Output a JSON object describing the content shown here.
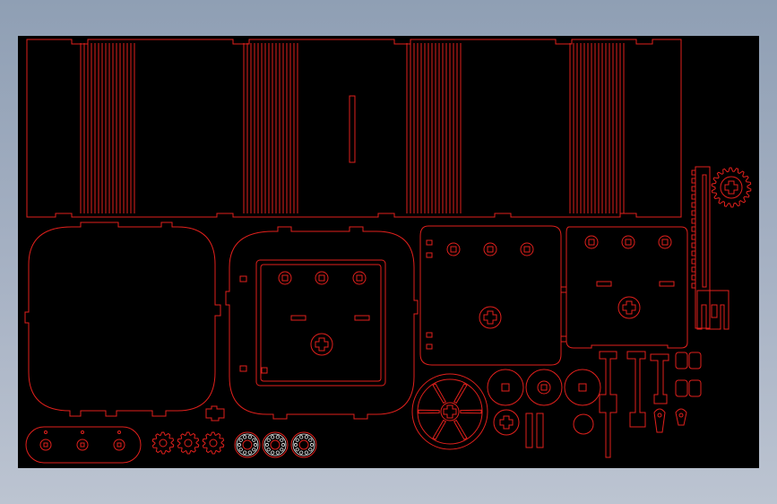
{
  "view": {
    "background": "#000000",
    "line_color": "#e0201c",
    "frame_colors": [
      "#8f9fb4",
      "#bcc4d1"
    ],
    "icons": [
      "cross-hole-icon",
      "gear-icon",
      "wheel-icon",
      "bearing-icon"
    ]
  }
}
